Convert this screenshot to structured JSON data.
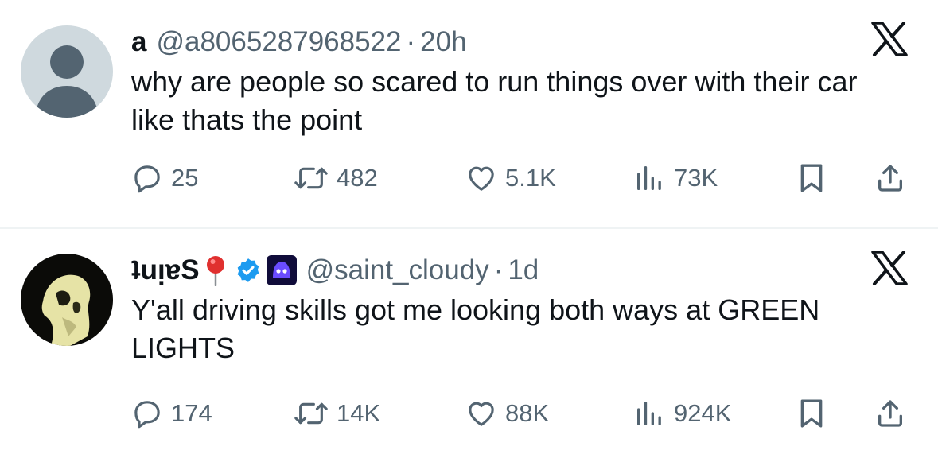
{
  "tweets": [
    {
      "name": "a",
      "handle": "@a8065287968522",
      "separator": "·",
      "time": "20h",
      "text": "why are people so scared to run things over with their car like thats the point",
      "replies": "25",
      "reposts": "482",
      "likes": "5.1K",
      "views": "73K"
    },
    {
      "name": "ʇuᴉɐS",
      "handle": "@saint_cloudy",
      "separator": "·",
      "time": "1d",
      "text": "Y'all driving skills got me looking both ways at GREEN LIGHTS",
      "replies": "174",
      "reposts": "14K",
      "likes": "88K",
      "views": "924K"
    }
  ],
  "icons": [
    "x-logo-icon",
    "reply-icon",
    "repost-icon",
    "like-icon",
    "views-icon",
    "bookmark-icon",
    "share-icon",
    "verified-badge-icon",
    "pushpin-icon",
    "space-invader-icon"
  ],
  "colors": {
    "text": "#0f1419",
    "secondary": "#536471",
    "verified": "#1d9bf0",
    "divider": "#eff3f4"
  }
}
